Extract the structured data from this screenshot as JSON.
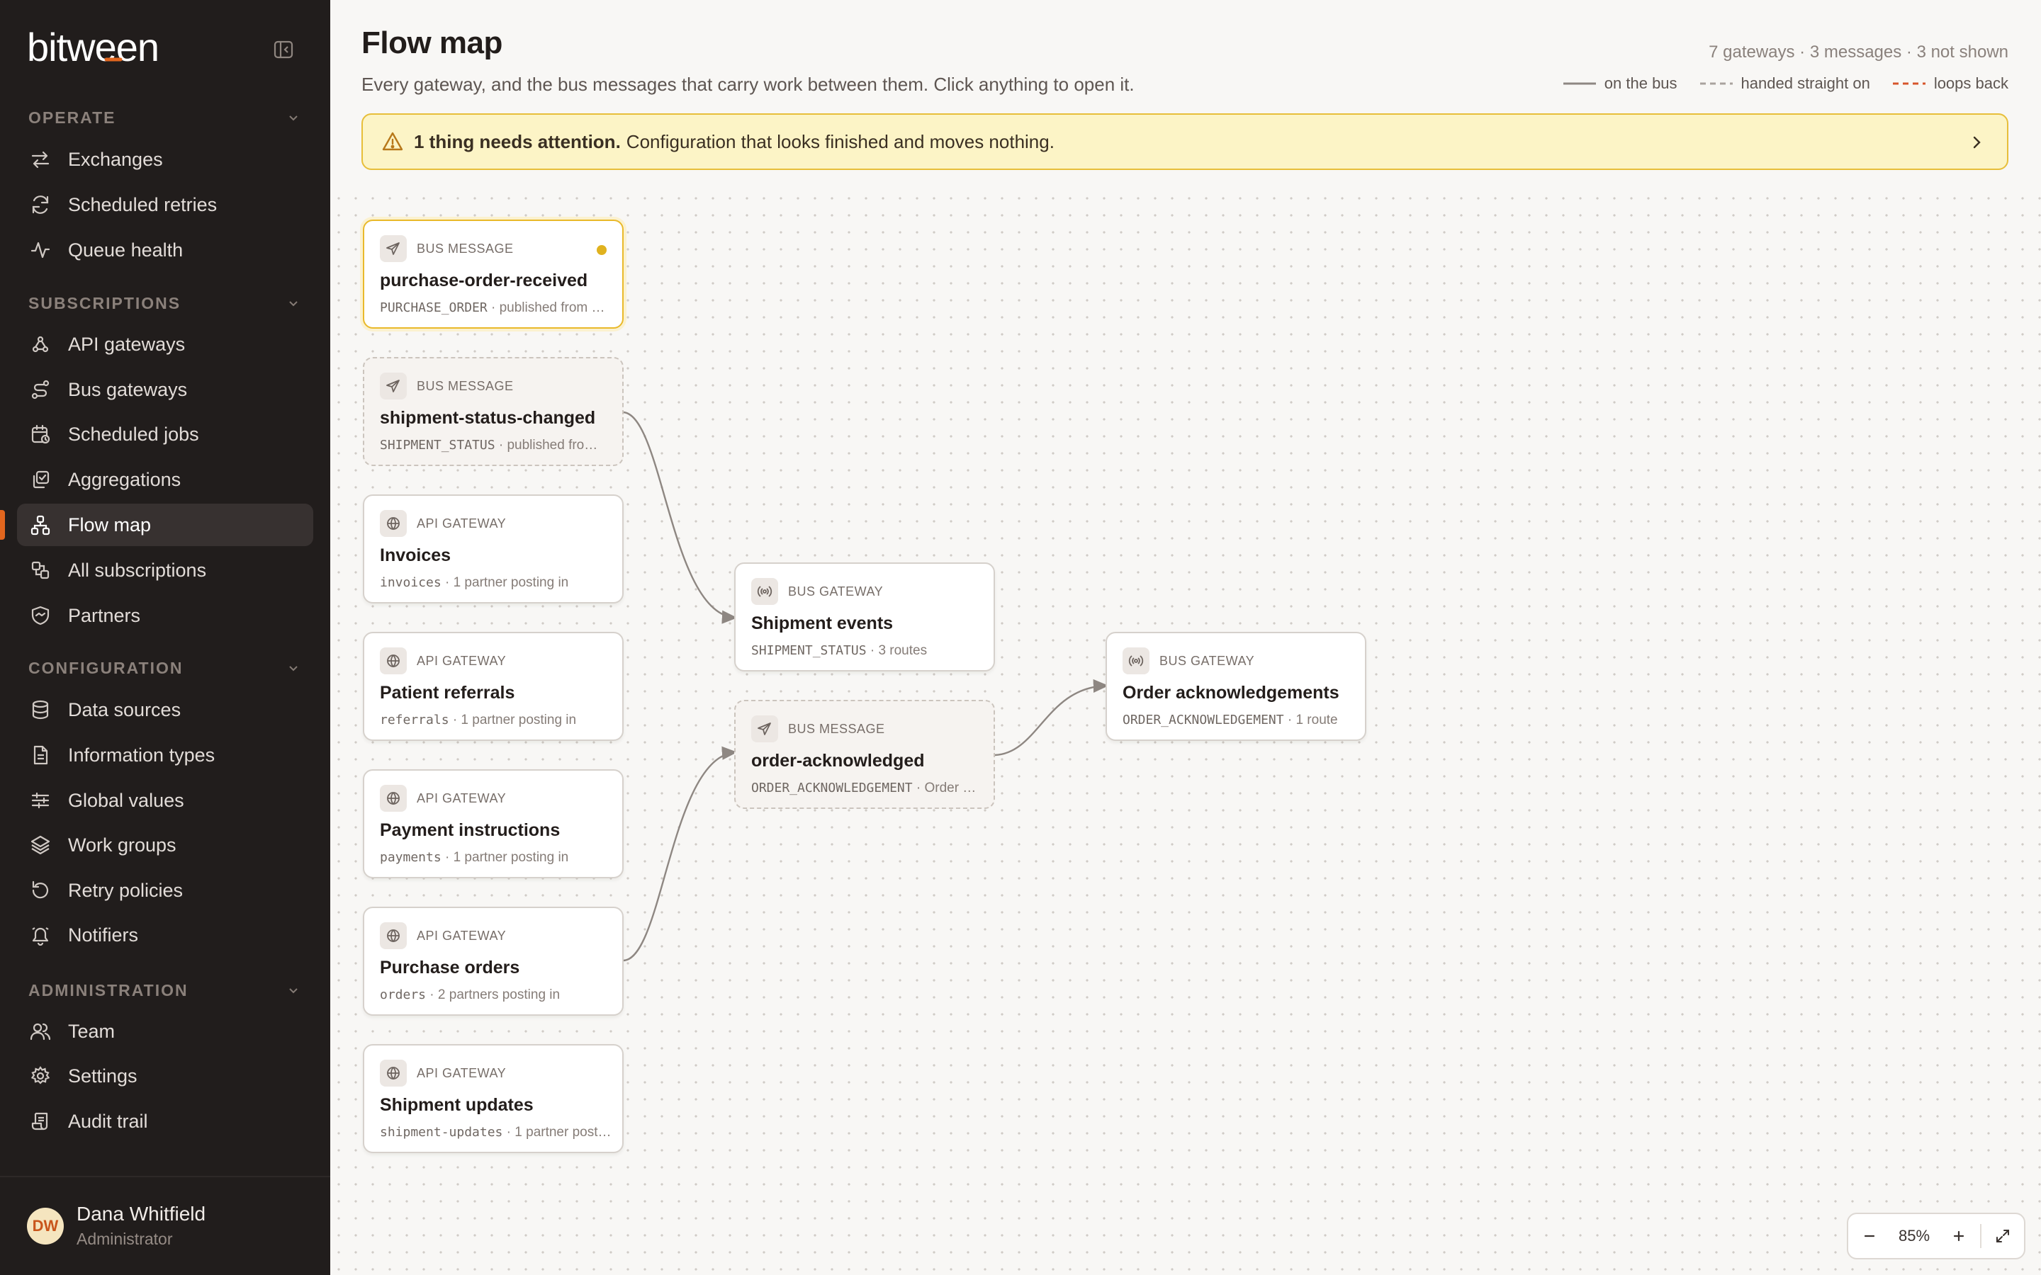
{
  "app": {
    "logo_text": "bitween",
    "user": {
      "initials": "DW",
      "name": "Dana Whitfield",
      "role": "Administrator"
    }
  },
  "sidebar": {
    "sections": [
      {
        "title": "OPERATE",
        "items": [
          "Exchanges",
          "Scheduled retries",
          "Queue health"
        ]
      },
      {
        "title": "SUBSCRIPTIONS",
        "items": [
          "API gateways",
          "Bus gateways",
          "Scheduled jobs",
          "Aggregations",
          "Flow map",
          "All subscriptions",
          "Partners"
        ]
      },
      {
        "title": "CONFIGURATION",
        "items": [
          "Data sources",
          "Information types",
          "Global values",
          "Work groups",
          "Retry policies",
          "Notifiers"
        ]
      },
      {
        "title": "ADMINISTRATION",
        "items": [
          "Team",
          "Settings",
          "Audit trail"
        ]
      }
    ],
    "active_item": "Flow map"
  },
  "page": {
    "title": "Flow map",
    "subtitle": "Every gateway, and the bus messages that carry work between them. Click anything to open it.",
    "counts": "7 gateways · 3 messages · 3 not shown",
    "legend": [
      {
        "label": "on the bus",
        "style": "solid",
        "color": "#8e8782"
      },
      {
        "label": "handed straight on",
        "style": "dashed",
        "color": "#aaa39e"
      },
      {
        "label": "loops back",
        "style": "dashed",
        "color": "#d7552b"
      }
    ]
  },
  "alert": {
    "strong": "1 thing needs attention.",
    "text": "Configuration that looks finished and moves nothing."
  },
  "nodes": [
    {
      "id": "n1",
      "kind": "BUS MESSAGE",
      "title": "purchase-order-received",
      "code": "PURCHASE_ORDER",
      "meta": " · published from …",
      "icon": "send-icon",
      "highlighted": true
    },
    {
      "id": "n2",
      "kind": "BUS MESSAGE",
      "title": "shipment-status-changed",
      "code": "SHIPMENT_STATUS",
      "meta": " · published fro…",
      "icon": "send-icon"
    },
    {
      "id": "n3",
      "kind": "API GATEWAY",
      "title": "Invoices",
      "code": "invoices",
      "meta": " · 1 partner posting in",
      "icon": "globe-icon"
    },
    {
      "id": "n4",
      "kind": "API GATEWAY",
      "title": "Patient referrals",
      "code": "referrals",
      "meta": " · 1 partner posting in",
      "icon": "globe-icon"
    },
    {
      "id": "n5",
      "kind": "API GATEWAY",
      "title": "Payment instructions",
      "code": "payments",
      "meta": " · 1 partner posting in",
      "icon": "globe-icon"
    },
    {
      "id": "n6",
      "kind": "API GATEWAY",
      "title": "Purchase orders",
      "code": "orders",
      "meta": " · 2 partners posting in",
      "icon": "globe-icon"
    },
    {
      "id": "n7",
      "kind": "API GATEWAY",
      "title": "Shipment updates",
      "code": "shipment-updates",
      "meta": " · 1 partner post…",
      "icon": "globe-icon"
    },
    {
      "id": "n8",
      "kind": "BUS GATEWAY",
      "title": "Shipment events",
      "code": "SHIPMENT_STATUS",
      "meta": " · 3 routes",
      "icon": "broadcast-icon"
    },
    {
      "id": "n9",
      "kind": "BUS MESSAGE",
      "title": "order-acknowledged",
      "code": "ORDER_ACKNOWLEDGEMENT",
      "meta": " · Order …",
      "icon": "send-icon"
    },
    {
      "id": "n10",
      "kind": "BUS GATEWAY",
      "title": "Order acknowledgements",
      "code": "ORDER_ACKNOWLEDGEMENT",
      "meta": " · 1 route",
      "icon": "broadcast-icon"
    }
  ],
  "zoom": {
    "level": "85%"
  }
}
